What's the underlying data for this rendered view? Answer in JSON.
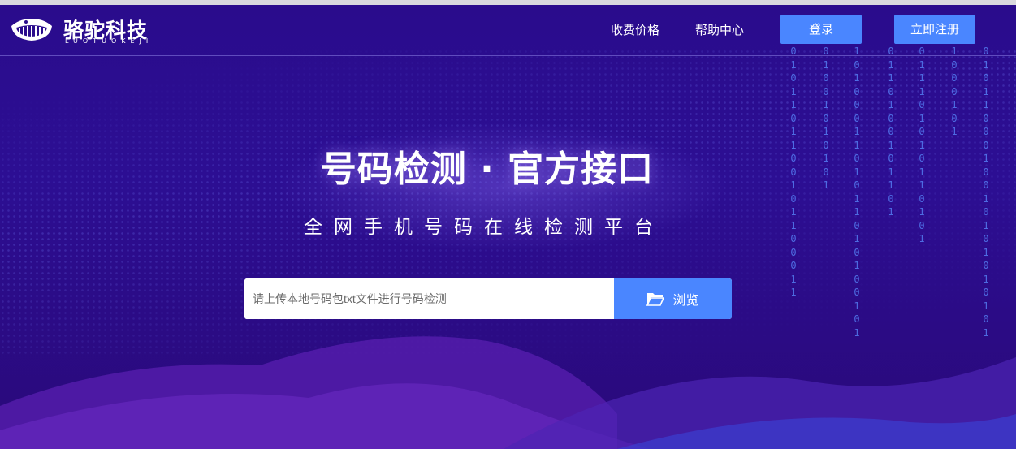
{
  "brand": {
    "name": "骆驼科技",
    "sub": "LUOTUOKEJI"
  },
  "nav": {
    "pricing": "收费价格",
    "help": "帮助中心",
    "login": "登录",
    "register": "立即注册"
  },
  "hero": {
    "title": "号码检测 · 官方接口",
    "subtitle": "全网手机号码在线检测平台"
  },
  "search": {
    "placeholder": "请上传本地号码包txt文件进行号码检测",
    "browse_label": "浏览"
  },
  "decor": {
    "binary_columns": [
      "0101101100101100011",
      "01001010101",
      "1010001101011010100101",
      "0110100101101",
      "011101010110101",
      "1000101",
      "0101100010010101010101"
    ]
  },
  "colors": {
    "background": "#2a0c8c",
    "accent": "#4a86ff"
  }
}
